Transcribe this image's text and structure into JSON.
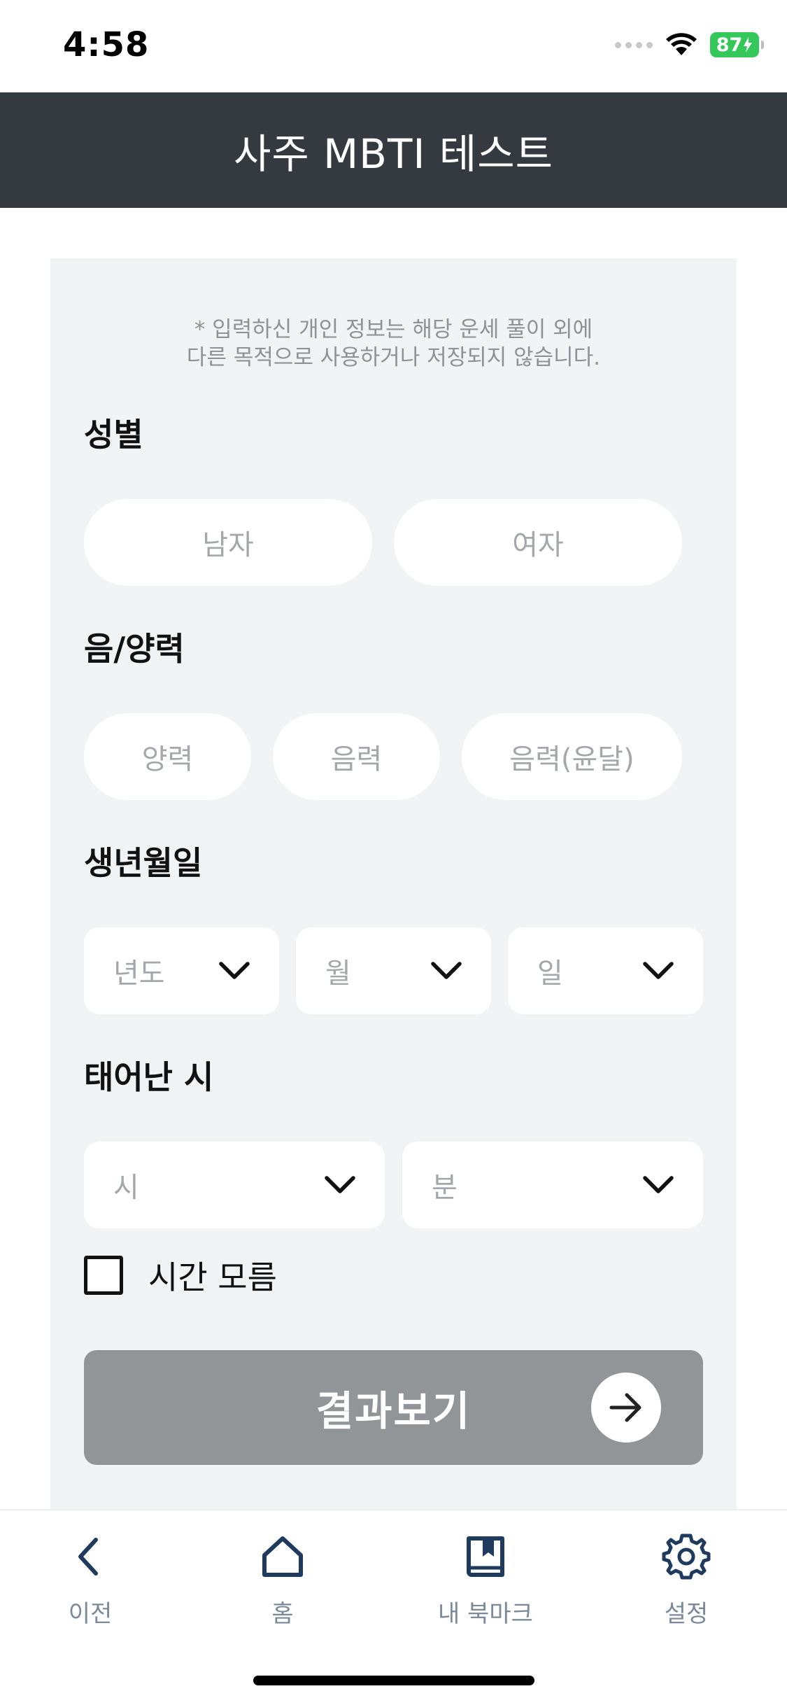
{
  "status_bar": {
    "time": "4:58",
    "battery": "87"
  },
  "header": {
    "title": "사주 MBTI 테스트"
  },
  "form": {
    "notice_line1": "* 입력하신 개인 정보는 해당 운세 풀이 외에",
    "notice_line2": "다른 목적으로 사용하거나 저장되지 않습니다.",
    "gender": {
      "title": "성별",
      "options": [
        "남자",
        "여자"
      ]
    },
    "calendar": {
      "title": "음/양력",
      "options": [
        "양력",
        "음력",
        "음력(윤달)"
      ]
    },
    "birthdate": {
      "title": "생년월일",
      "year_placeholder": "년도",
      "month_placeholder": "월",
      "day_placeholder": "일"
    },
    "birthtime": {
      "title": "태어난 시",
      "hour_placeholder": "시",
      "minute_placeholder": "분"
    },
    "unknown_time_label": "시간 모름",
    "submit_label": "결과보기"
  },
  "bottom_nav": {
    "items": [
      {
        "label": "이전",
        "icon": "chevron-left-icon"
      },
      {
        "label": "홈",
        "icon": "home-icon"
      },
      {
        "label": "내 북마크",
        "icon": "bookmark-book-icon"
      },
      {
        "label": "설정",
        "icon": "gear-icon"
      }
    ]
  },
  "colors": {
    "header_bg": "#353a40",
    "nav_icon": "#1f3a5f",
    "button_bg": "#919598",
    "battery": "#34c759"
  }
}
